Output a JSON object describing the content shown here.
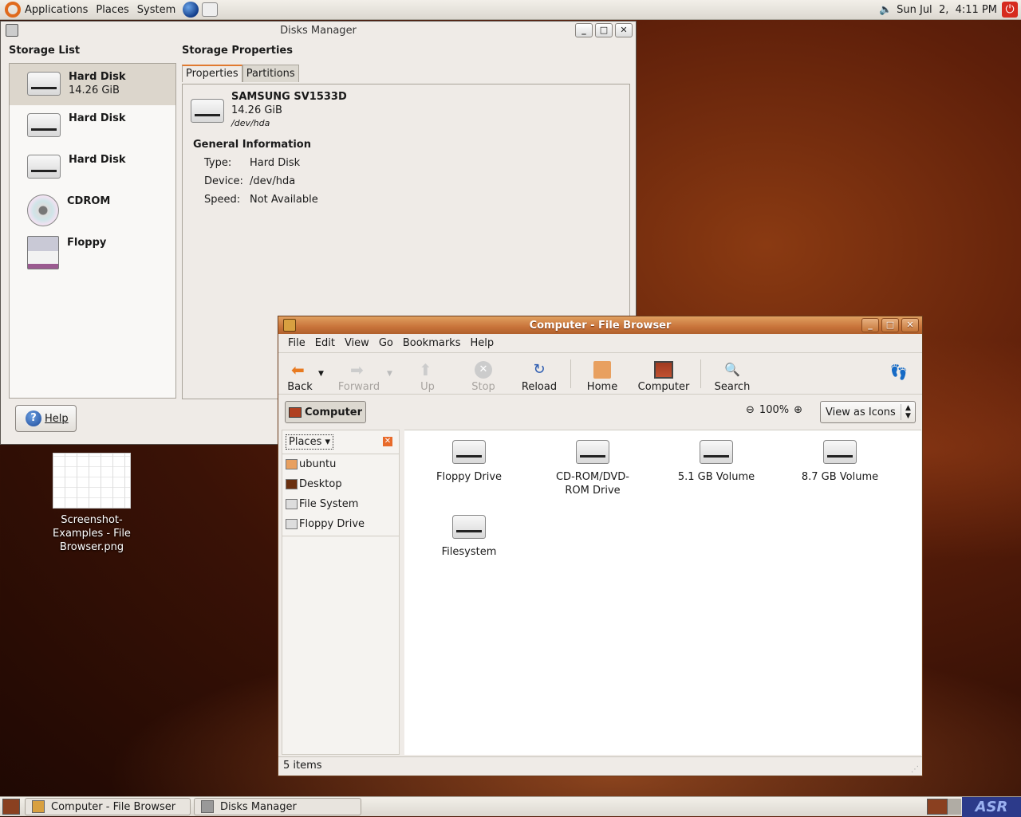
{
  "top_panel": {
    "menus": [
      "Applications",
      "Places",
      "System"
    ],
    "clock": "Sun Jul  2,  4:11 PM"
  },
  "disks_manager": {
    "title": "Disks Manager",
    "storage_list_title": "Storage List",
    "storage_properties_title": "Storage Properties",
    "storage_items": [
      {
        "label": "Hard Disk",
        "sub": "14.26 GiB",
        "icon": "harddisk-icon",
        "selected": true
      },
      {
        "label": "Hard Disk",
        "sub": "",
        "icon": "harddisk-icon"
      },
      {
        "label": "Hard Disk",
        "sub": "",
        "icon": "harddisk-icon"
      },
      {
        "label": "CDROM",
        "sub": "",
        "icon": "cdrom-icon"
      },
      {
        "label": "Floppy",
        "sub": "",
        "icon": "floppy-icon"
      }
    ],
    "tabs": [
      "Properties",
      "Partitions"
    ],
    "active_tab": "Properties",
    "device_name": "SAMSUNG SV1533D",
    "device_size": "14.26 GiB",
    "device_path": "/dev/hda",
    "general_info_title": "General Information",
    "info": [
      {
        "key": "Type:",
        "value": "Hard Disk"
      },
      {
        "key": "Device:",
        "value": "/dev/hda"
      },
      {
        "key": "Speed:",
        "value": "Not Available"
      }
    ],
    "help_label": "Help"
  },
  "file_browser": {
    "title": "Computer - File Browser",
    "menus": [
      "File",
      "Edit",
      "View",
      "Go",
      "Bookmarks",
      "Help"
    ],
    "toolbar": [
      {
        "label": "Back",
        "icon": "back-arrow-icon",
        "enabled": true
      },
      {
        "label": "Forward",
        "icon": "forward-arrow-icon",
        "enabled": false
      },
      {
        "label": "Up",
        "icon": "up-arrow-icon",
        "enabled": false
      },
      {
        "label": "Stop",
        "icon": "stop-icon",
        "enabled": false
      },
      {
        "label": "Reload",
        "icon": "reload-icon",
        "enabled": true
      },
      {
        "label": "Home",
        "icon": "home-folder-icon",
        "enabled": true
      },
      {
        "label": "Computer",
        "icon": "computer-icon",
        "enabled": true
      },
      {
        "label": "Search",
        "icon": "search-icon",
        "enabled": true
      }
    ],
    "location": "Computer",
    "zoom_level": "100%",
    "view_mode": "View as Icons",
    "places_label": "Places",
    "places": [
      "ubuntu",
      "Desktop",
      "File System",
      "Floppy Drive"
    ],
    "items": [
      {
        "label": "Floppy Drive"
      },
      {
        "label": "CD-ROM/DVD-ROM Drive"
      },
      {
        "label": "5.1 GB Volume"
      },
      {
        "label": "8.7 GB Volume"
      },
      {
        "label": "Filesystem"
      }
    ],
    "status": "5 items"
  },
  "desktop_icon": {
    "label": "Screenshot-Examples - File Browser.png"
  },
  "taskbar": {
    "tasks": [
      "Computer - File Browser",
      "Disks Manager"
    ]
  },
  "colors": {
    "accent": "#e07a30",
    "titlebar_active": "#c8733a"
  }
}
